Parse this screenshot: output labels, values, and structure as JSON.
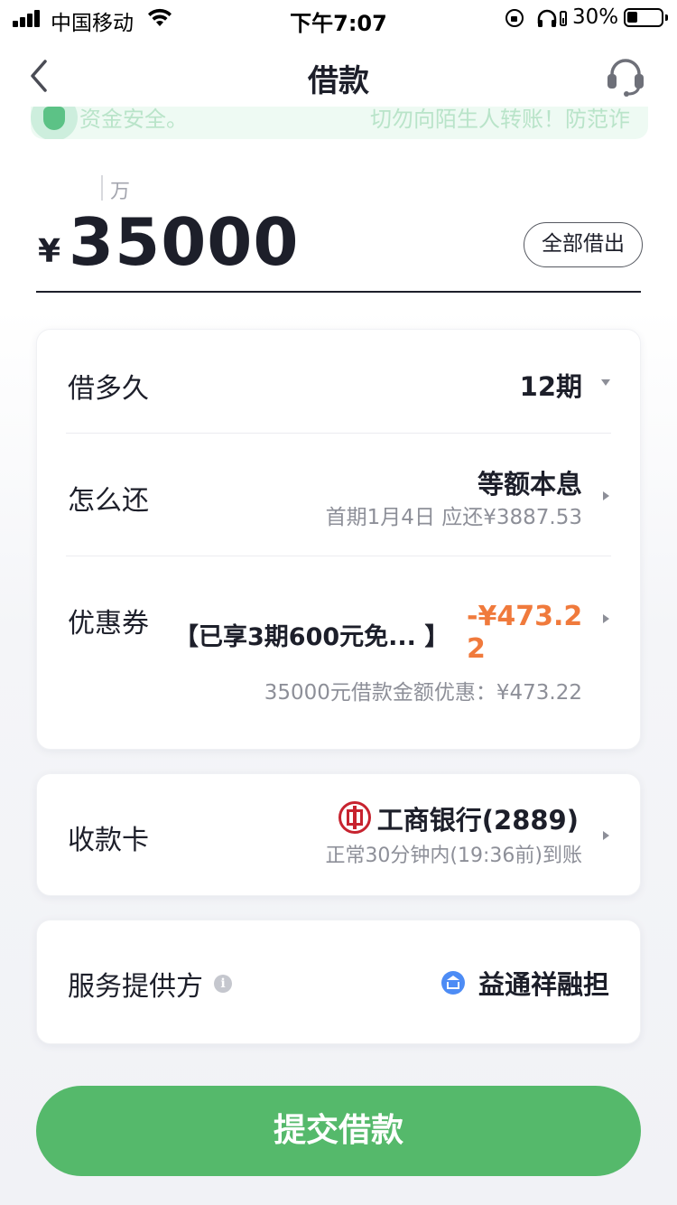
{
  "status_bar": {
    "carrier": "中国移动",
    "time": "下午7:07",
    "battery": "30%"
  },
  "nav": {
    "title": "借款",
    "back_icon": "chevron-left-icon",
    "service_icon": "headset-icon"
  },
  "notice": {
    "left_text": "资金安全。",
    "right_text": "切勿向陌生人转账！防范诈"
  },
  "amount": {
    "unit_hint": "万",
    "currency": "¥",
    "value": "35000",
    "borrow_all_label": "全部借出"
  },
  "loan_details": {
    "term": {
      "label": "借多久",
      "value": "12期"
    },
    "repayment": {
      "label": "怎么还",
      "method": "等额本息",
      "first_payment": "首期1月4日  应还¥3887.53"
    },
    "coupon": {
      "label": "优惠券",
      "text": "【已享3期600元免...  】",
      "discount": "-¥473.22",
      "detail": "35000元借款金额优惠：¥473.22"
    }
  },
  "receiving_card": {
    "label": "收款卡",
    "bank": "工商银行(2889)",
    "arrival": "正常30分钟内(19:36前)到账",
    "bank_icon": "icbc-logo-icon"
  },
  "provider": {
    "label": "服务提供方",
    "info_icon": "info-icon",
    "name": "益通祥融担"
  },
  "submit": {
    "label": "提交借款"
  },
  "colors": {
    "primary_green": "#55b96b",
    "discount_orange": "#f07a3c",
    "text_dark": "#1d1f2a",
    "text_muted": "#8d8f98",
    "icbc_red": "#c7232f",
    "provider_blue": "#4d8cf5"
  }
}
